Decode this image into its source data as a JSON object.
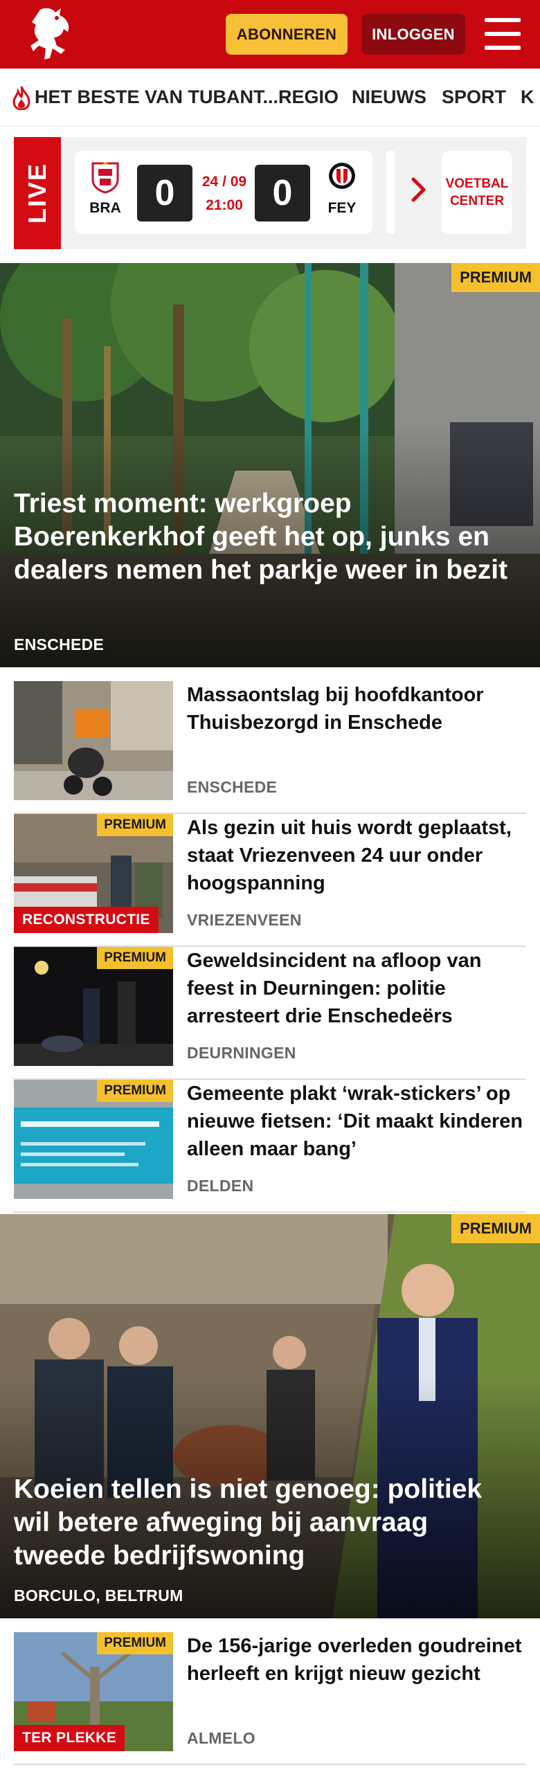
{
  "header": {
    "logo_icon": "tubantia-horse-logo-icon",
    "subscribe_label": "ABONNEREN",
    "login_label": "INLOGGEN",
    "menu_icon": "hamburger-menu-icon",
    "brand_color": "#c9070f"
  },
  "nav": {
    "items": [
      {
        "label": "HET BESTE VAN TUBANT...",
        "icon": "flame-icon"
      },
      {
        "label": "REGIO"
      },
      {
        "label": "NIEUWS"
      },
      {
        "label": "SPORT"
      },
      {
        "label": "K"
      }
    ]
  },
  "live": {
    "tag": "LIVE",
    "match": {
      "home_abbr": "BRA",
      "home_score": "0",
      "date": "24 / 09",
      "time": "21:00",
      "away_score": "0",
      "away_abbr": "FEY"
    },
    "voetbal_center": {
      "line1": "VOETBAL",
      "line2": "CENTER"
    }
  },
  "hero1": {
    "premium": "PREMIUM",
    "title": "Triest moment: werkgroep Boerenkerkhof geeft het op, junks en dealers nemen het parkje weer in bezit",
    "location": "ENSCHEDE"
  },
  "articles": [
    {
      "title": "Massaontslag bij hoofdkantoor Thuisbezorgd in Enschede",
      "location": "ENSCHEDE",
      "premium": "",
      "tag": ""
    },
    {
      "title": "Als gezin uit huis wordt geplaatst, staat Vriezenveen 24 uur onder hoogspanning",
      "location": "VRIEZENVEEN",
      "premium": "PREMIUM",
      "tag": "RECONSTRUCTIE"
    },
    {
      "title": "Geweldsincident na afloop van feest in Deurningen: politie arresteert drie Enschedeërs",
      "location": "DEURNINGEN",
      "premium": "PREMIUM",
      "tag": ""
    },
    {
      "title": "Gemeente plakt ‘wrak-stickers’ op nieuwe fietsen: ‘Dit maakt kinderen alleen maar bang’",
      "location": "DELDEN",
      "premium": "PREMIUM",
      "tag": ""
    }
  ],
  "hero2": {
    "premium": "PREMIUM",
    "title": "Koeien tellen is niet genoeg: politiek wil betere afweging bij aanvraag tweede bedrijfswoning",
    "location": "BORCULO, BELTRUM"
  },
  "article_after": {
    "title": "De 156-jarige overleden goudreinet herleeft en krijgt nieuw gezicht",
    "location": "ALMELO",
    "premium": "PREMIUM",
    "tag": "TER PLEKKE"
  }
}
